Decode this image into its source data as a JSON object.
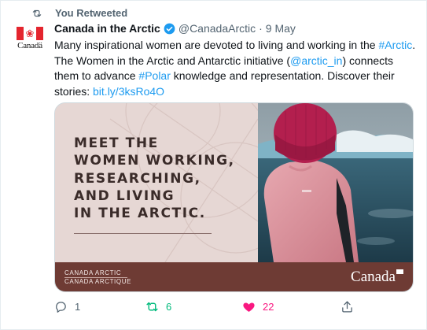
{
  "social_context": {
    "label": "You Retweeted"
  },
  "author": {
    "name": "Canada in the Arctic",
    "handle": "@CanadaArctic",
    "separator": "·",
    "date": "9 May",
    "avatar_wordmark": "Canadä"
  },
  "tweet": {
    "text_1": "Many inspirational women are devoted to living and working in the ",
    "hashtag_1": "#Arctic",
    "text_2": ". The Women in the Arctic and Antarctic initiative (",
    "mention": "@arctic_in",
    "text_3": ") connects them to advance ",
    "hashtag_2": "#Polar",
    "text_4": " knowledge and representation. Discover their stories: ",
    "link": "bit.ly/3ksRo4O"
  },
  "media": {
    "headline_lines": [
      "MEET THE",
      "WOMEN WORKING,",
      "RESEARCHING,",
      "AND LIVING",
      "IN THE ARCTIC."
    ],
    "brand_en": "CANADA ARCTIC",
    "brand_fr": "CANADA ARCTIQUE",
    "wordmark": "Canada"
  },
  "actions": {
    "replies": "1",
    "retweets": "6",
    "likes": "22"
  },
  "colors": {
    "link": "#1d9bf0",
    "retweet_active": "#00ba7c",
    "like_active": "#f91880",
    "band": "#6e3b34"
  }
}
